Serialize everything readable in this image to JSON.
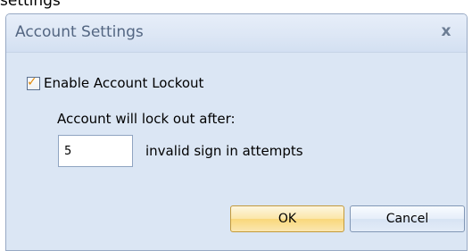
{
  "context": {
    "partial_text": "settings"
  },
  "dialog": {
    "title": "Account Settings",
    "close_glyph": "x",
    "enable_lockout": {
      "label": "Enable Account Lockout",
      "checked": true
    },
    "lock_out_label": "Account will lock out after:",
    "attempts_value": "5",
    "attempts_suffix": "invalid sign in attempts",
    "ok_label": "OK",
    "cancel_label": "Cancel"
  }
}
